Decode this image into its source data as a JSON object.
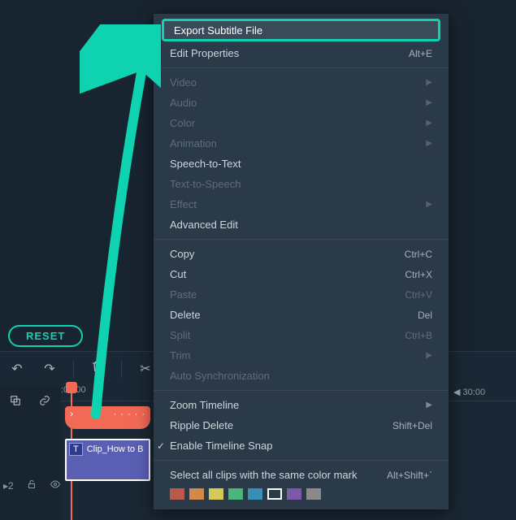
{
  "reset_label": "RESET",
  "toolbar": {
    "undo": "undo-icon",
    "redo": "redo-icon",
    "delete": "trash-icon",
    "cut": "scissors-icon",
    "history": "history-icon"
  },
  "timeline": {
    "tick_start": ":00:00",
    "tick_end": "30:00",
    "playhead_chevron": "›",
    "clip_badge": "T",
    "clip_label": "Clip_How to B",
    "row_badge": "▸2"
  },
  "ctx": {
    "export_subtitle": "Export Subtitle File",
    "edit_properties": {
      "label": "Edit Properties",
      "shortcut": "Alt+E"
    },
    "video": "Video",
    "audio": "Audio",
    "color": "Color",
    "animation": "Animation",
    "speech_to_text": "Speech-to-Text",
    "text_to_speech": "Text-to-Speech",
    "effect": "Effect",
    "advanced_edit": "Advanced Edit",
    "copy": {
      "label": "Copy",
      "shortcut": "Ctrl+C"
    },
    "cut": {
      "label": "Cut",
      "shortcut": "Ctrl+X"
    },
    "paste": {
      "label": "Paste",
      "shortcut": "Ctrl+V"
    },
    "delete": {
      "label": "Delete",
      "shortcut": "Del"
    },
    "split": {
      "label": "Split",
      "shortcut": "Ctrl+B"
    },
    "trim": "Trim",
    "auto_sync": "Auto Synchronization",
    "zoom_timeline": "Zoom Timeline",
    "ripple_delete": {
      "label": "Ripple Delete",
      "shortcut": "Shift+Del"
    },
    "enable_snap": "Enable Timeline Snap",
    "select_color": {
      "label": "Select all clips with the same color mark",
      "shortcut": "Alt+Shift+`"
    }
  },
  "colors": [
    "#b85a4a",
    "#d28a4a",
    "#d6c95b",
    "#4bb47a",
    "#3a8fb5",
    "#ffffff",
    "#7a5aa8",
    "#8a8a8a"
  ]
}
